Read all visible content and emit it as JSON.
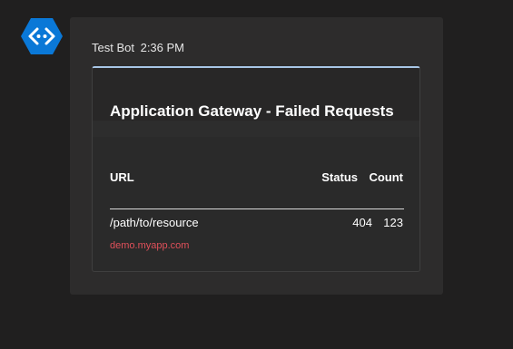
{
  "bot": {
    "name": "Test Bot",
    "time": "2:36 PM",
    "avatar_icon": "azure-bot-icon",
    "avatar_color": "#0078d4"
  },
  "card": {
    "title": "Application Gateway - Failed Requests",
    "accent_color": "#a8c6e6",
    "columns": [
      "URL",
      "Status",
      "Count"
    ],
    "rows": [
      {
        "url": "/path/to/resource",
        "status": "404",
        "count": "123"
      }
    ],
    "link": {
      "text": "demo.myapp.com",
      "color": "#e0505a"
    }
  }
}
